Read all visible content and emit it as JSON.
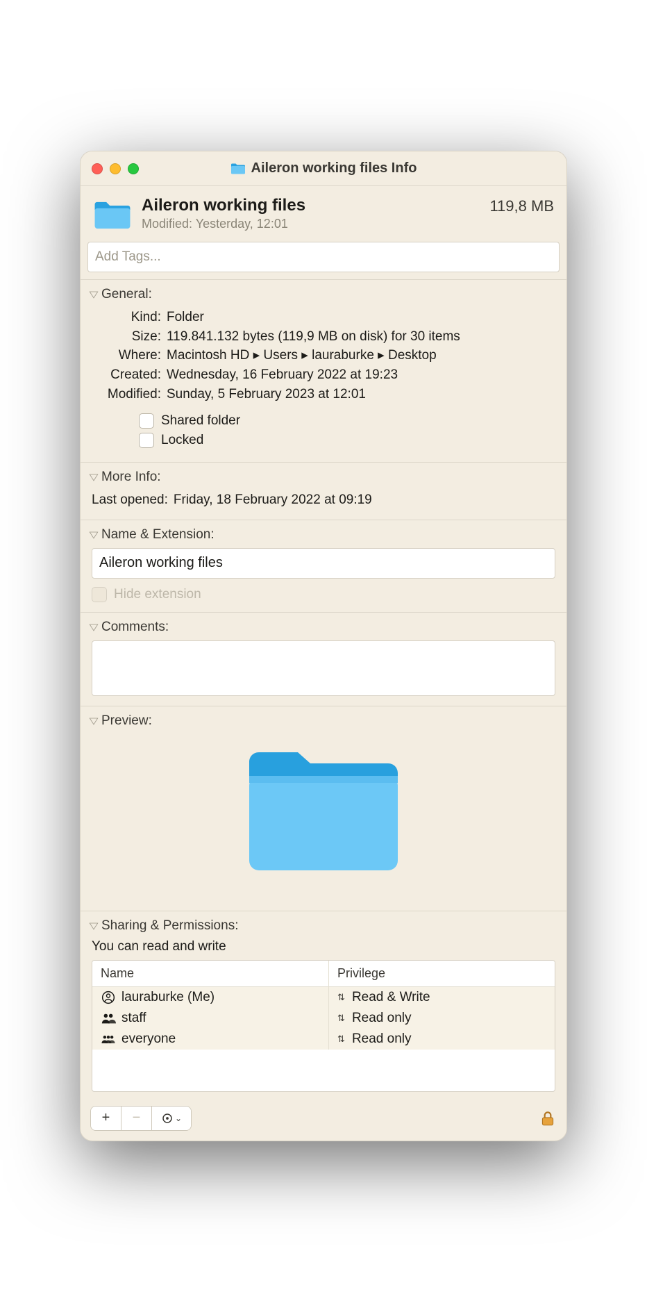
{
  "window_title": "Aileron working files Info",
  "header": {
    "name": "Aileron working files",
    "modified_label": "Modified:",
    "modified_value": "Yesterday, 12:01",
    "size": "119,8 MB"
  },
  "tags": {
    "placeholder": "Add Tags..."
  },
  "sections": {
    "general": {
      "title": "General:",
      "kind_label": "Kind:",
      "kind_value": "Folder",
      "size_label": "Size:",
      "size_value": "119.841.132 bytes (119,9 MB on disk) for 30 items",
      "where_label": "Where:",
      "where_value": "Macintosh HD ▸ Users ▸ lauraburke ▸ Desktop",
      "created_label": "Created:",
      "created_value": "Wednesday, 16 February 2022 at 19:23",
      "modified_label": "Modified:",
      "modified_value": "Sunday, 5 February 2023 at 12:01",
      "shared_label": "Shared folder",
      "locked_label": "Locked"
    },
    "more_info": {
      "title": "More Info:",
      "last_opened_label": "Last opened:",
      "last_opened_value": "Friday, 18 February 2022 at 09:19"
    },
    "name_ext": {
      "title": "Name & Extension:",
      "value": "Aileron working files",
      "hide_ext_label": "Hide extension"
    },
    "comments": {
      "title": "Comments:"
    },
    "preview": {
      "title": "Preview:"
    },
    "sharing": {
      "title": "Sharing & Permissions:",
      "status": "You can read and write",
      "col_name": "Name",
      "col_priv": "Privilege",
      "rows": [
        {
          "icon": "user",
          "name": "lauraburke (Me)",
          "priv": "Read & Write"
        },
        {
          "icon": "group",
          "name": "staff",
          "priv": "Read only"
        },
        {
          "icon": "group3",
          "name": "everyone",
          "priv": "Read only"
        }
      ]
    }
  },
  "bottom": {
    "add": "+",
    "remove": "−",
    "gear": "⊙",
    "chev": "ˇ"
  }
}
